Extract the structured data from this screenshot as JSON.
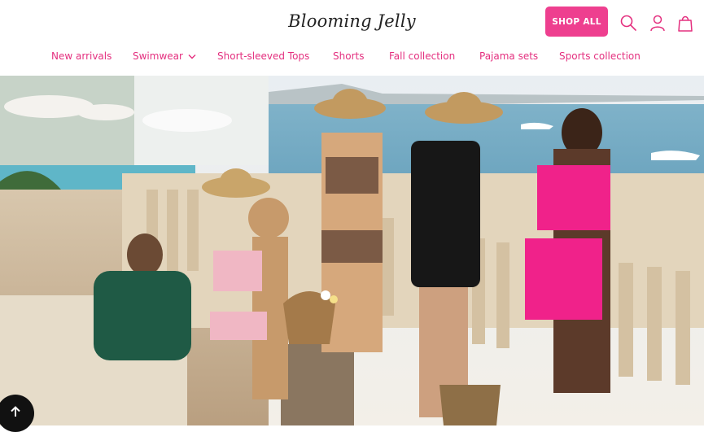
{
  "brand": {
    "logo_text": "Blooming Jelly"
  },
  "header": {
    "shop_all_label": "SHOP ALL",
    "icons": [
      "search-icon",
      "account-icon",
      "cart-icon"
    ]
  },
  "nav": {
    "items": [
      {
        "label": "New arrivals"
      },
      {
        "label": "Swimwear",
        "has_dropdown": true
      },
      {
        "label": "Short-sleeved Tops"
      },
      {
        "label": "Shorts"
      },
      {
        "label": "Fall collection"
      },
      {
        "label": "Pajama sets"
      },
      {
        "label": "Sports collection"
      }
    ]
  },
  "hero": {
    "image": "hero-photo"
  },
  "back_to_top": {
    "icon": "arrow-up-icon"
  },
  "colors": {
    "accent": "#ee3f8f",
    "nav_text": "#e4307f",
    "logo": "#222222",
    "back_to_top_bg": "#111111"
  }
}
